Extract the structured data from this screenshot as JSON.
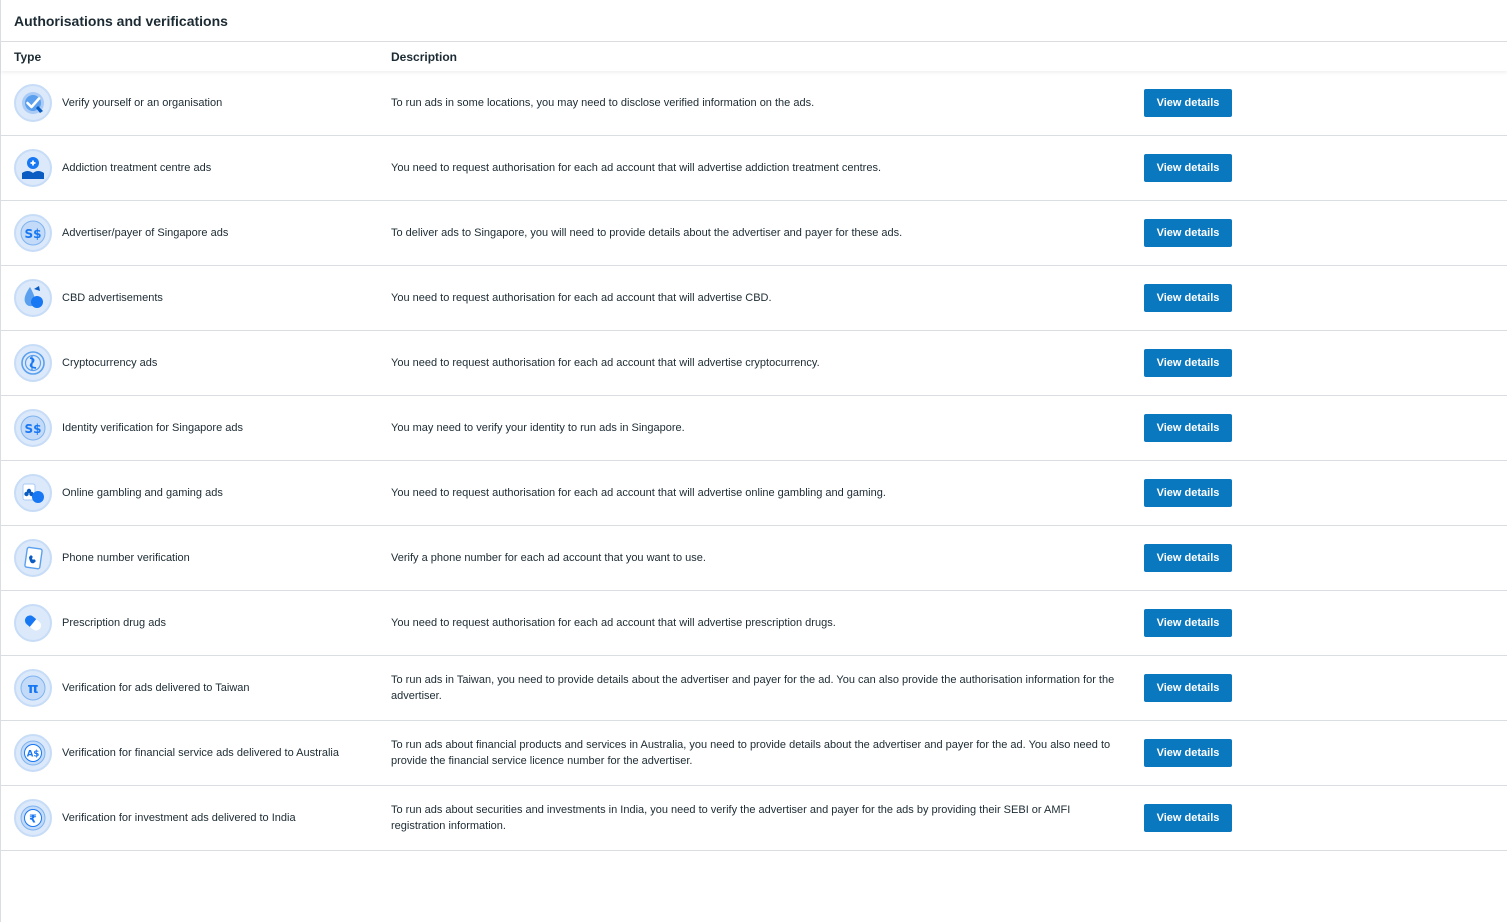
{
  "section": {
    "title": "Authorisations and verifications"
  },
  "table": {
    "headers": {
      "type": "Type",
      "description": "Description"
    },
    "button_label": "View details",
    "rows": [
      {
        "icon": "verified-badge-icon",
        "type": "Verify yourself or an organisation",
        "description": "To run ads in some locations, you may need to disclose verified information on the ads."
      },
      {
        "icon": "addiction-treatment-icon",
        "type": "Addiction treatment centre ads",
        "description": "You need to request authorisation for each ad account that will advertise addiction treatment centres."
      },
      {
        "icon": "singapore-dollar-icon",
        "type": "Advertiser/payer of Singapore ads",
        "description": "To deliver ads to Singapore, you will need to provide details about the advertiser and payer for these ads."
      },
      {
        "icon": "cbd-drop-icon",
        "type": "CBD advertisements",
        "description": "You need to request authorisation for each ad account that will advertise CBD."
      },
      {
        "icon": "cryptocurrency-icon",
        "type": "Cryptocurrency ads",
        "description": "You need to request authorisation for each ad account that will advertise cryptocurrency."
      },
      {
        "icon": "singapore-dollar-icon",
        "type": "Identity verification for Singapore ads",
        "description": "You may need to verify your identity to run ads in Singapore."
      },
      {
        "icon": "gambling-cards-icon",
        "type": "Online gambling and gaming ads",
        "description": "You need to request authorisation for each ad account that will advertise online gambling and gaming."
      },
      {
        "icon": "phone-icon",
        "type": "Phone number verification",
        "description": "Verify a phone number for each ad account that you want to use."
      },
      {
        "icon": "pill-icon",
        "type": "Prescription drug ads",
        "description": "You need to request authorisation for each ad account that will advertise prescription drugs."
      },
      {
        "icon": "taiwan-currency-icon",
        "type": "Verification for ads delivered to Taiwan",
        "description": "To run ads in Taiwan, you need to provide details about the advertiser and payer for the ad. You can also provide the authorisation information for the advertiser."
      },
      {
        "icon": "australian-dollar-icon",
        "type": "Verification for financial service ads delivered to Australia",
        "description": "To run ads about financial products and services in Australia, you need to provide details about the advertiser and payer for the ad. You also need to provide the financial service licence number for the advertiser."
      },
      {
        "icon": "rupee-icon",
        "type": "Verification for investment ads delivered to India",
        "description": "To run ads about securities and investments in India, you need to verify the advertiser and payer for the ads by providing their SEBI or AMFI registration information."
      }
    ]
  },
  "icon_glyphs": {
    "singapore": "S$",
    "taiwan": "π",
    "australia": "A$",
    "india": "₹"
  },
  "colors": {
    "button": "#0a78be",
    "icon_bg": "#dbe9fb",
    "icon_blue": "#1877f2",
    "icon_dark": "#0a5cc2",
    "border": "#dadde1"
  }
}
